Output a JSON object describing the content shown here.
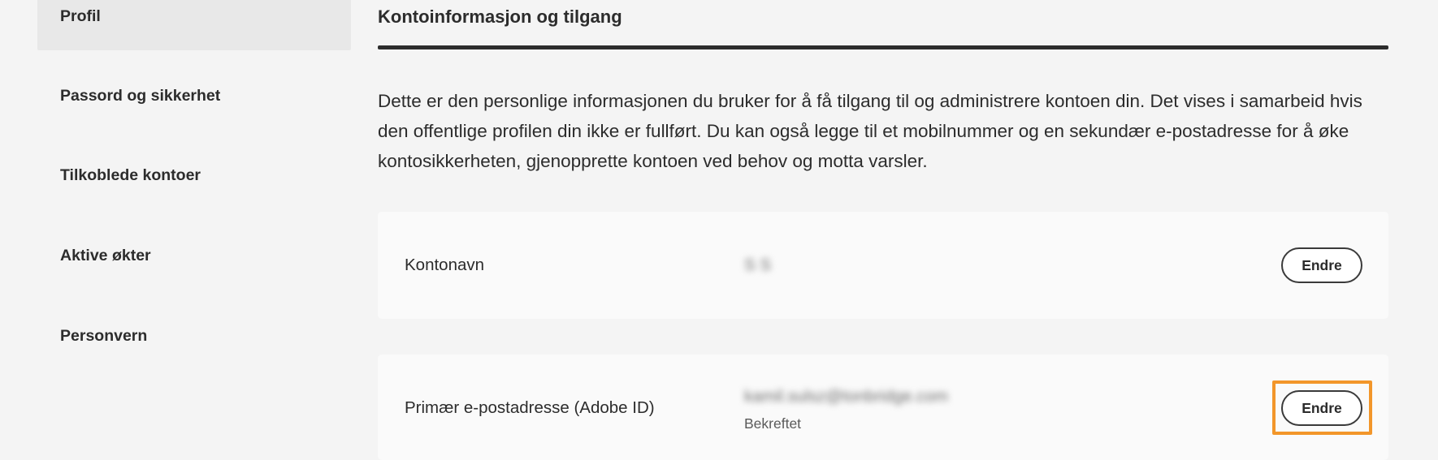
{
  "sidebar": {
    "items": [
      {
        "label": "Profil",
        "active": true
      },
      {
        "label": "Passord og sikkerhet"
      },
      {
        "label": "Tilkoblede kontoer"
      },
      {
        "label": "Aktive økter"
      },
      {
        "label": "Personvern"
      }
    ]
  },
  "main": {
    "title": "Kontoinformasjon og tilgang",
    "intro": "Dette er den personlige informasjonen du bruker for å få tilgang til og administrere kontoen din. Det vises i samarbeid hvis den offentlige profilen din ikke er fullført. Du kan også legge til et mobilnummer og en sekundær e-postadresse for å øke kontosikkerheten, gjenopprette kontoen ved behov og motta varsler.",
    "cards": [
      {
        "label": "Kontonavn",
        "value": "S S",
        "button": "Endre"
      },
      {
        "label": "Primær e-postadresse (Adobe ID)",
        "value": "kamil.sulsz@tonbridge.com",
        "status": "Bekreftet",
        "button": "Endre"
      }
    ]
  },
  "colors": {
    "background": "#f4f4f4",
    "card": "#fafafa",
    "text": "#2c2c2c",
    "highlight": "#f2962a"
  }
}
